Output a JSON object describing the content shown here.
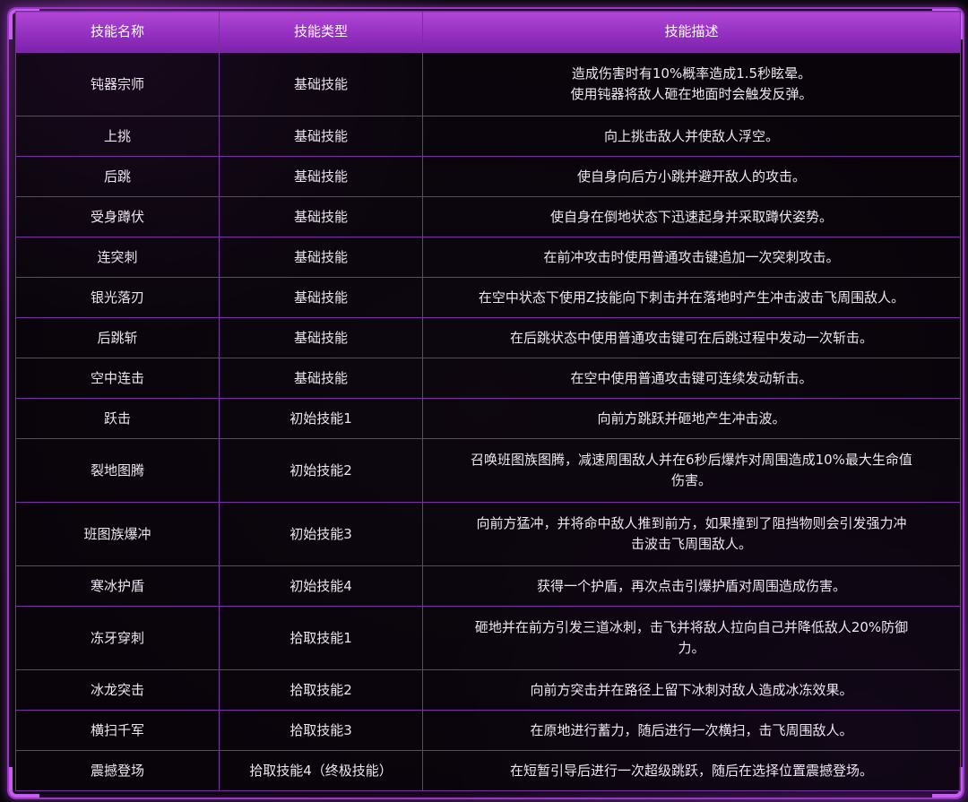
{
  "headers": [
    "技能名称",
    "技能类型",
    "技能描述"
  ],
  "rows": [
    {
      "name": "钝器宗师",
      "type": "基础技能",
      "desc": "造成伤害时有10%概率造成1.5秒眩晕。\n使用钝器将敌人砸在地面时会触发反弹。"
    },
    {
      "name": "上挑",
      "type": "基础技能",
      "desc": "向上挑击敌人并使敌人浮空。"
    },
    {
      "name": "后跳",
      "type": "基础技能",
      "desc": "使自身向后方小跳并避开敌人的攻击。"
    },
    {
      "name": "受身蹲伏",
      "type": "基础技能",
      "desc": "使自身在倒地状态下迅速起身并采取蹲伏姿势。"
    },
    {
      "name": "连突刺",
      "type": "基础技能",
      "desc": "在前冲攻击时使用普通攻击键追加一次突刺攻击。"
    },
    {
      "name": "银光落刃",
      "type": "基础技能",
      "desc": "在空中状态下使用Z技能向下刺击并在落地时产生冲击波击飞周围敌人。"
    },
    {
      "name": "后跳斩",
      "type": "基础技能",
      "desc": "在后跳状态中使用普通攻击键可在后跳过程中发动一次斩击。"
    },
    {
      "name": "空中连击",
      "type": "基础技能",
      "desc": "在空中使用普通攻击键可连续发动斩击。"
    },
    {
      "name": "跃击",
      "type": "初始技能1",
      "desc": "向前方跳跃并砸地产生冲击波。"
    },
    {
      "name": "裂地图腾",
      "type": "初始技能2",
      "desc": "召唤班图族图腾，减速周围敌人并在6秒后爆炸对周围造成10%最大生命值\n伤害。"
    },
    {
      "name": "班图族爆冲",
      "type": "初始技能3",
      "desc": "向前方猛冲，并将命中敌人推到前方，如果撞到了阻挡物则会引发强力冲\n击波击飞周围敌人。"
    },
    {
      "name": "寒冰护盾",
      "type": "初始技能4",
      "desc": "获得一个护盾，再次点击引爆护盾对周围造成伤害。"
    },
    {
      "name": "冻牙穿刺",
      "type": "拾取技能1",
      "desc": "砸地并在前方引发三道冰刺，击飞并将敌人拉向自己并降低敌人20%防御\n力。"
    },
    {
      "name": "冰龙突击",
      "type": "拾取技能2",
      "desc": "向前方突击并在路径上留下冰刺对敌人造成冰冻效果。"
    },
    {
      "name": "横扫千军",
      "type": "拾取技能3",
      "desc": "在原地进行蓄力，随后进行一次横扫，击飞周围敌人。"
    },
    {
      "name": "震撼登场",
      "type": "拾取技能4（终极技能）",
      "desc": "在短暂引导后进行一次超级跳跃，随后在选择位置震撼登场。"
    }
  ],
  "colors": {
    "header": "#9330c0",
    "border": "#7a2fa3",
    "frame": "#c75cf0",
    "background": "#0d0710"
  }
}
